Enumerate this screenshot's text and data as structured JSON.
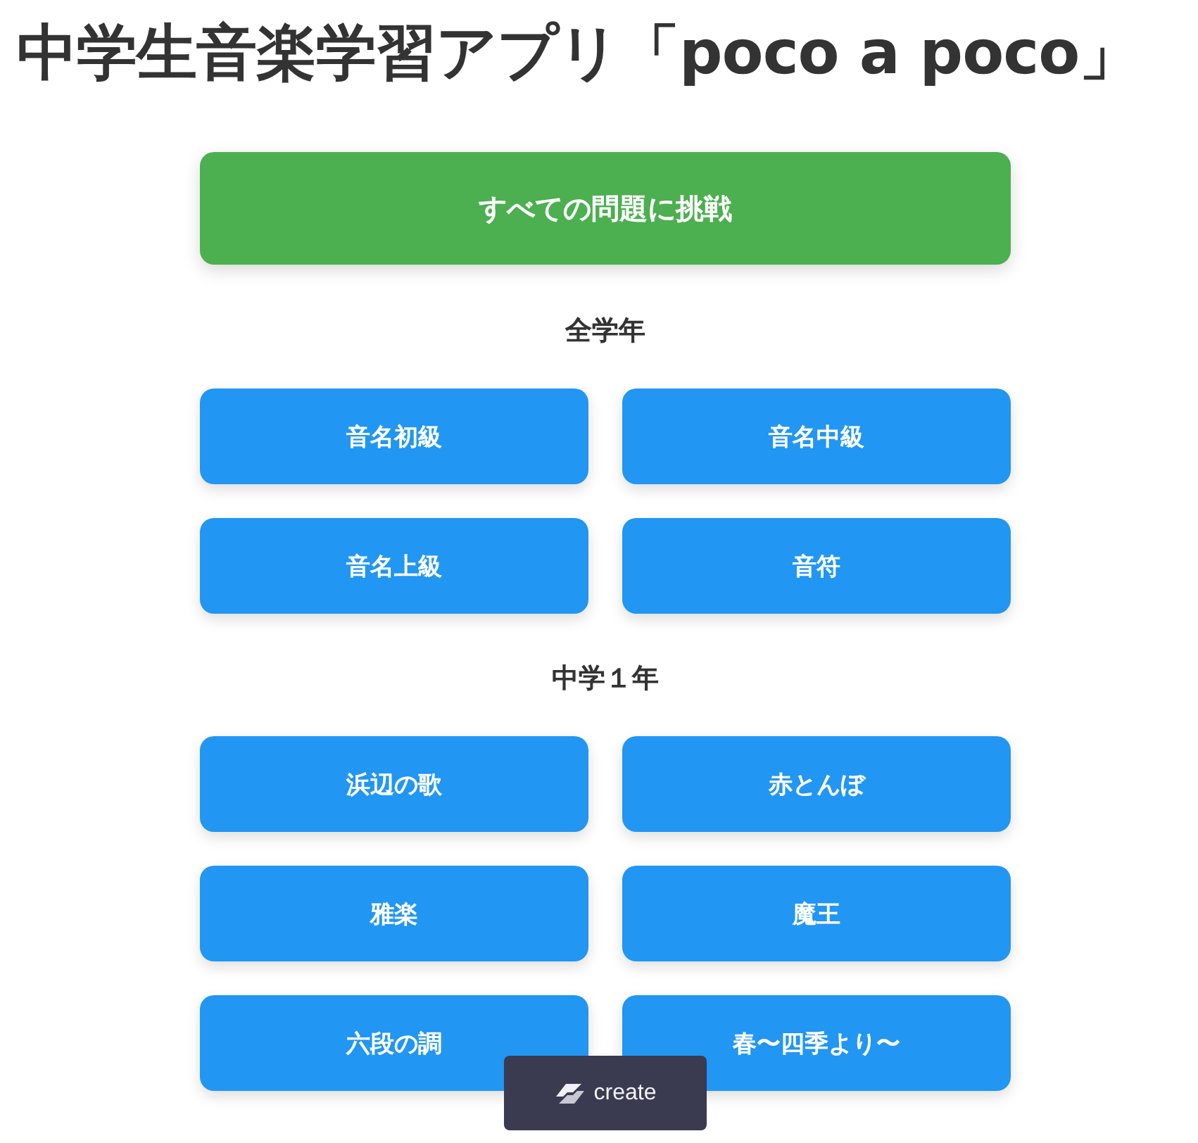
{
  "title": "中学生音楽学習アプリ「poco a poco」",
  "main_button": "すべての問題に挑戦",
  "sections": [
    {
      "heading": "全学年",
      "buttons": [
        "音名初級",
        "音名中級",
        "音名上級",
        "音符"
      ]
    },
    {
      "heading": "中学１年",
      "buttons": [
        "浜辺の歌",
        "赤とんぼ",
        "雅楽",
        "魔王",
        "六段の調",
        "春〜四季より〜"
      ]
    }
  ],
  "badge": {
    "label": "create"
  }
}
